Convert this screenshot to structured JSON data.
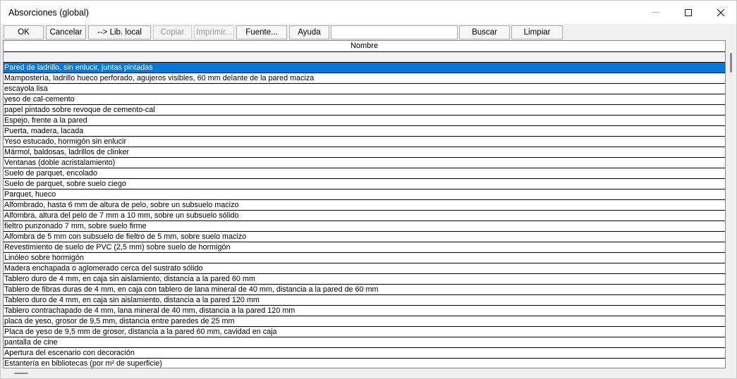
{
  "window": {
    "title": "Absorciones (global)"
  },
  "toolbar": {
    "ok": "OK",
    "cancel": "Cancelar",
    "lib_local": "--> Lib. local",
    "copy": "Copiar",
    "print": "Imprimir...",
    "source": "Fuente...",
    "help": "Ayuda",
    "search_value": "",
    "search_btn": "Buscar",
    "clear": "Limpiar"
  },
  "table": {
    "header": "Nombre",
    "selected_index": 0,
    "rows": [
      "Pared de ladrillo, sin enlucir, juntas pintadas",
      "Mampostería, ladrillo hueco perforado, agujeros visibles, 60 mm delante de la pared maciza",
      "escayola lisa",
      "yeso de cal-cemento",
      "papel pintado sobre revoque de cemento-cal",
      "Espejo, frente a la pared",
      "Puerta, madera, lacada",
      "Yeso estucado, hormigón sin enlucir",
      "Mármol, baldosas, ladrillos de clinker",
      "Ventanas (doble acristalamiento)",
      "Suelo de parquet, encolado",
      "Suelo de parquet, sobre suelo ciego",
      "Parquet, hueco",
      "Alfombrado, hasta 6 mm de altura de pelo, sobre un subsuelo macizo",
      "Alfombra, altura del pelo de 7 mm a 10 mm, sobre un subsuelo sólido",
      "fieltro punzonado 7 mm, sobre suelo firme",
      "Alfombra de 5 mm con subsuelo de fieltro de 5 mm, sobre suelo macizo",
      "Revestimiento de suelo de PVC (2,5 mm) sobre suelo de hormigón",
      "Linóleo sobre hormigón",
      "Madera enchapada o aglomerado cerca del sustrato sólido",
      "Tablero duro de 4 mm, en caja sin aislamiento, distancia a la pared 60 mm",
      "Tablero de fibras duras de 4 mm, en caja con tablero de lana mineral de 40 mm, distancia a la pared de 60 mm",
      "Tablero duro de 4 mm, en caja sin aislamiento, distancia a la pared 120 mm",
      "Tablero contrachapado de 4 mm, lana mineral de 40 mm, distancia a la pared 120 mm",
      "placa de yeso, grosor de 9,5 mm, distancia entre paredes de 25 mm",
      "Placa de yeso de 9,5 mm de grosor, distancia a la pared 60 mm, cavidad en caja",
      "pantalla de cine",
      "Apertura del escenario con decoración",
      "Estantería en bibliotecas (por m² de superficie)"
    ]
  }
}
